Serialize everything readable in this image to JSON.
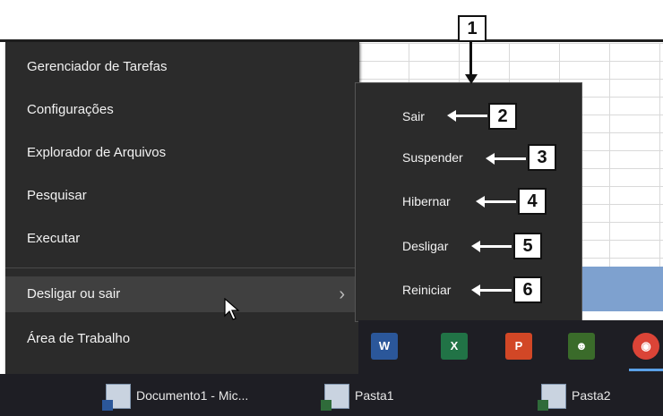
{
  "context_menu": {
    "items": [
      {
        "label": "Gerenciador de Tarefas"
      },
      {
        "label": "Configurações"
      },
      {
        "label": "Explorador de Arquivos"
      },
      {
        "label": "Pesquisar"
      },
      {
        "label": "Executar"
      },
      {
        "label": "Desligar ou sair",
        "has_submenu": true,
        "active": true
      },
      {
        "label": "Área de Trabalho"
      }
    ],
    "chevron": "›"
  },
  "submenu": {
    "items": [
      {
        "label": "Sair",
        "callout": "2"
      },
      {
        "label": "Suspender",
        "callout": "3"
      },
      {
        "label": "Hibernar",
        "callout": "4"
      },
      {
        "label": "Desligar",
        "callout": "5"
      },
      {
        "label": "Reiniciar",
        "callout": "6"
      }
    ]
  },
  "callout_top": "1",
  "taskbar": {
    "pinned": [
      {
        "name": "word-icon",
        "glyph": "W",
        "color": "#2b579a"
      },
      {
        "name": "excel-icon",
        "glyph": "X",
        "color": "#217346"
      },
      {
        "name": "powerpoint-icon",
        "glyph": "P",
        "color": "#d24726"
      },
      {
        "name": "user-icon",
        "glyph": "☻",
        "color": "#3a6b2a"
      },
      {
        "name": "chrome-icon",
        "glyph": "◉",
        "color": "#db4437"
      }
    ],
    "tasks": [
      {
        "label": "Documento1 - Mic..."
      },
      {
        "label": "Pasta1"
      },
      {
        "label": "Pasta2"
      }
    ]
  },
  "colors": {
    "menu_bg": "#2b2b2b",
    "active_bg": "#404040",
    "taskbar_bg": "#1e1e24",
    "sheet_band": "#7ea1cf"
  }
}
